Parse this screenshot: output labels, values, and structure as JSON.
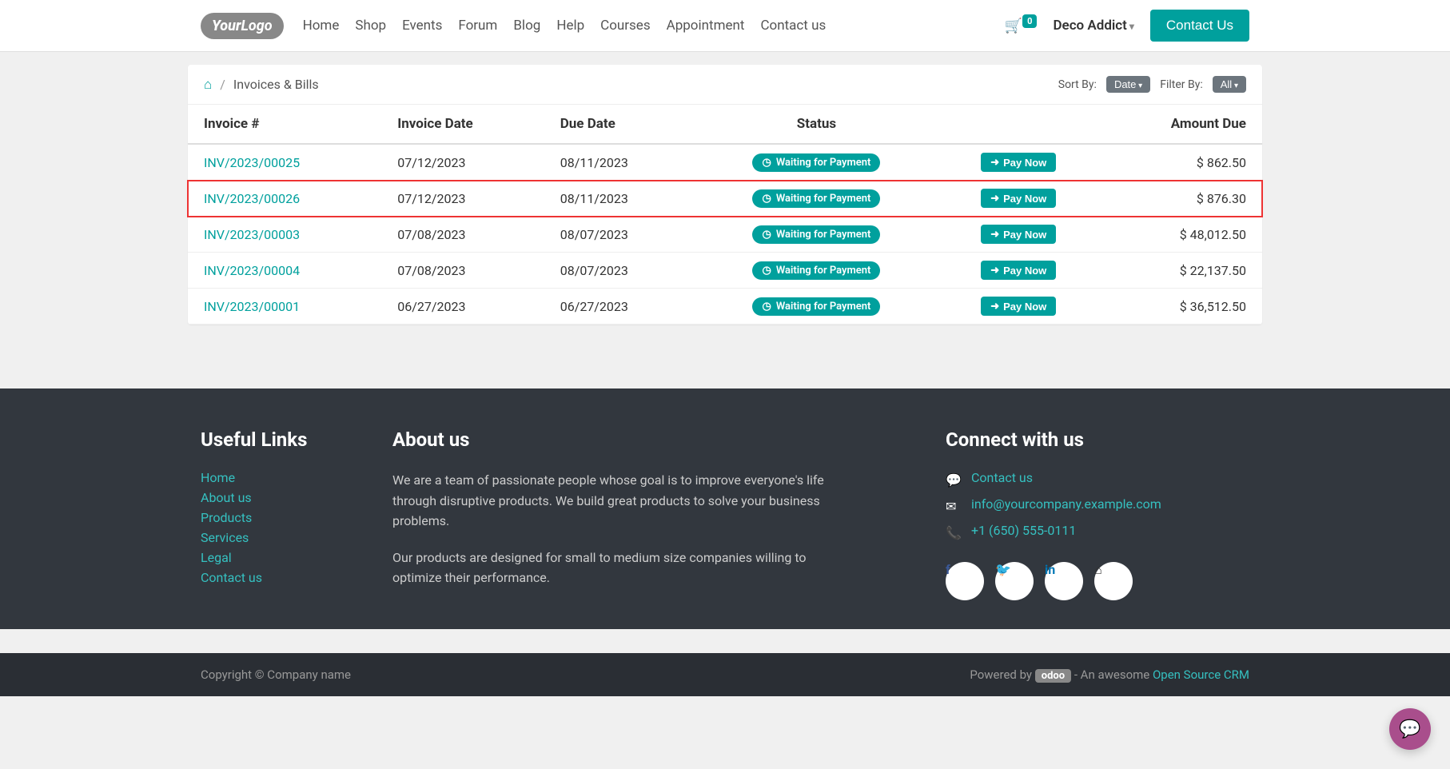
{
  "nav": {
    "logo_your": "Your",
    "logo_logo": "Logo",
    "links": [
      "Home",
      "Shop",
      "Events",
      "Forum",
      "Blog",
      "Help",
      "Courses",
      "Appointment",
      "Contact us"
    ],
    "cart_count": "0",
    "user": "Deco Addict",
    "contact_btn": "Contact Us"
  },
  "breadcrumb": {
    "page": "Invoices & Bills",
    "sort_label": "Sort By:",
    "sort_value": "Date",
    "filter_label": "Filter By:",
    "filter_value": "All"
  },
  "table": {
    "headers": [
      "Invoice #",
      "Invoice Date",
      "Due Date",
      "Status",
      "",
      "Amount Due"
    ],
    "status_text": "Waiting for Payment",
    "pay_text": "Pay Now",
    "rows": [
      {
        "num": "INV/2023/00025",
        "date": "07/12/2023",
        "due": "08/11/2023",
        "amount": "$ 862.50",
        "hl": false
      },
      {
        "num": "INV/2023/00026",
        "date": "07/12/2023",
        "due": "08/11/2023",
        "amount": "$ 876.30",
        "hl": true
      },
      {
        "num": "INV/2023/00003",
        "date": "07/08/2023",
        "due": "08/07/2023",
        "amount": "$ 48,012.50",
        "hl": false
      },
      {
        "num": "INV/2023/00004",
        "date": "07/08/2023",
        "due": "08/07/2023",
        "amount": "$ 22,137.50",
        "hl": false
      },
      {
        "num": "INV/2023/00001",
        "date": "06/27/2023",
        "due": "06/27/2023",
        "amount": "$ 36,512.50",
        "hl": false
      }
    ]
  },
  "footer": {
    "useful_title": "Useful Links",
    "useful_links": [
      "Home",
      "About us",
      "Products",
      "Services",
      "Legal",
      "Contact us"
    ],
    "about_title": "About us",
    "about_p1": "We are a team of passionate people whose goal is to improve everyone's life through disruptive products. We build great products to solve your business problems.",
    "about_p2": "Our products are designed for small to medium size companies willing to optimize their performance.",
    "connect_title": "Connect with us",
    "contact_link": "Contact us",
    "email": "info@yourcompany.example.com",
    "phone": "+1 (650) 555-0111",
    "copyright": "Copyright © Company name",
    "powered": "Powered by ",
    "odoo": "odoo",
    "awesome": " - An awesome ",
    "crm": "Open Source CRM"
  }
}
